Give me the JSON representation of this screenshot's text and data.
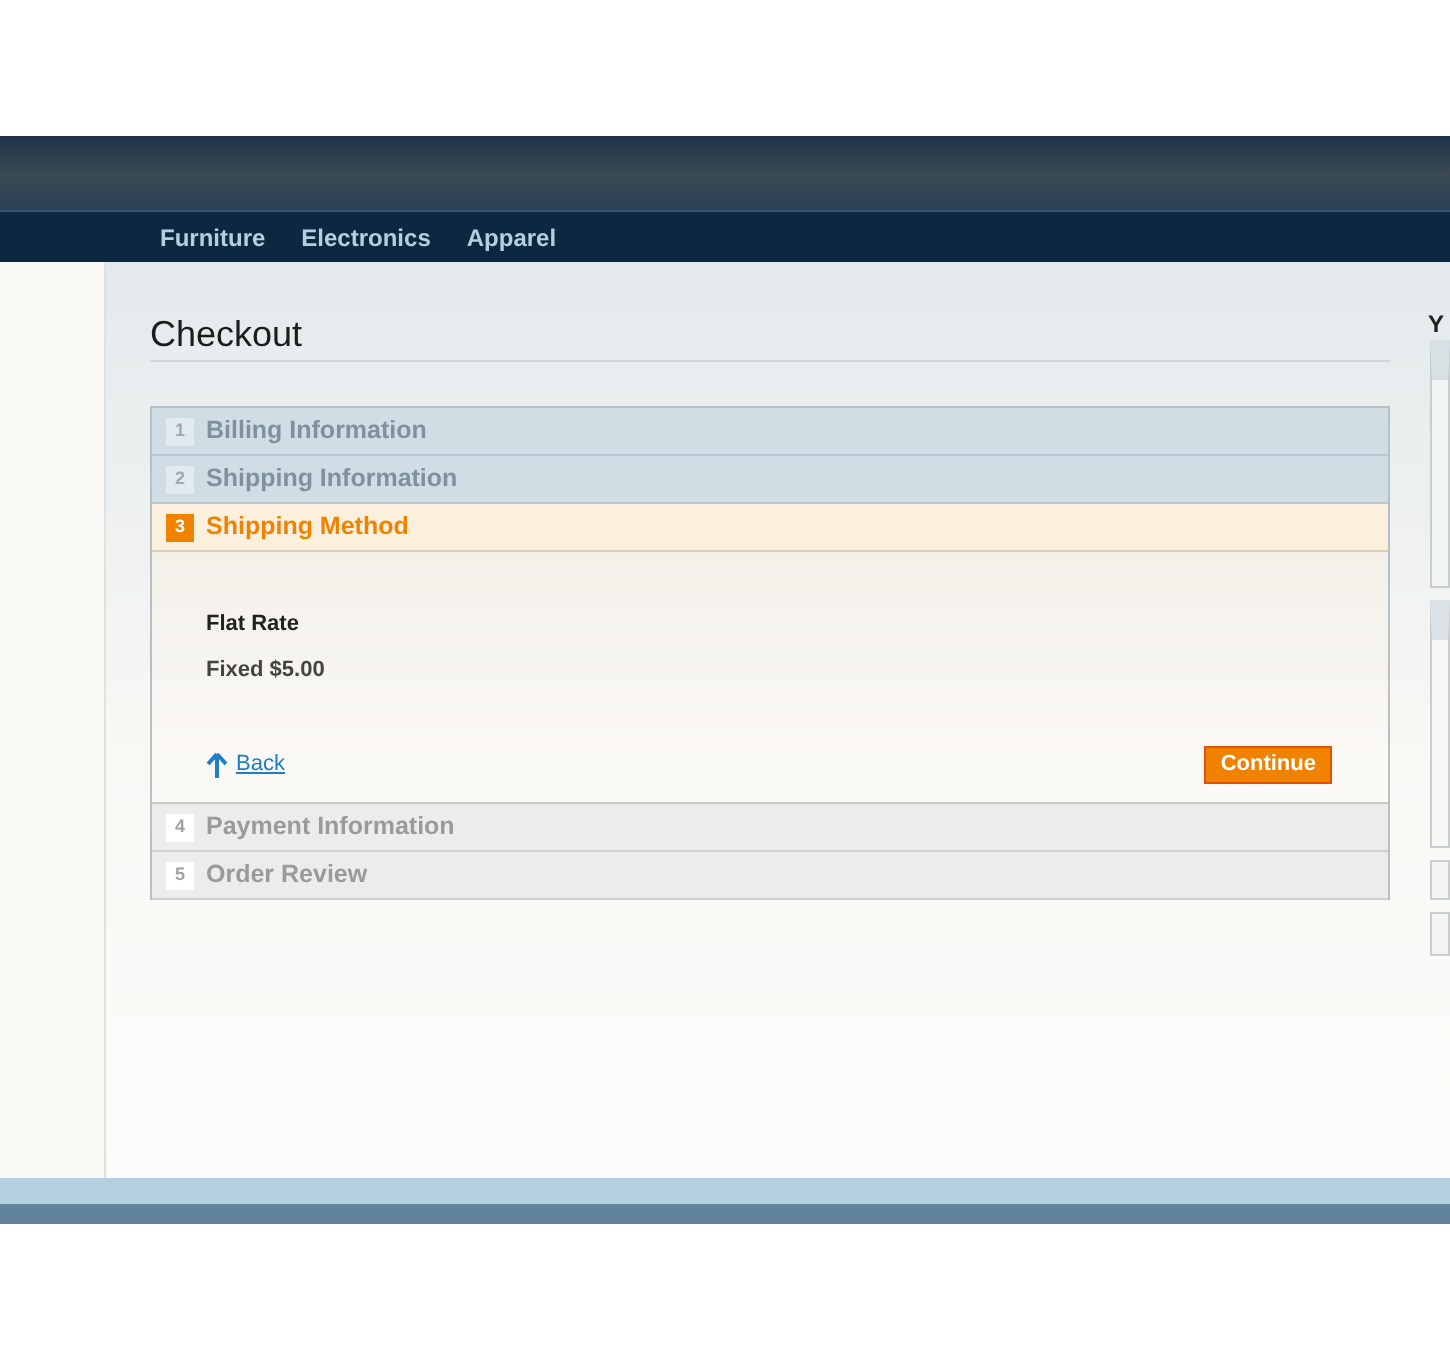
{
  "nav": {
    "items": [
      "Furniture",
      "Electronics",
      "Apparel"
    ]
  },
  "page_title": "Checkout",
  "steps": [
    {
      "number": "1",
      "label": "Billing Information",
      "kind": "complete"
    },
    {
      "number": "2",
      "label": "Shipping Information",
      "kind": "complete"
    },
    {
      "number": "3",
      "label": "Shipping Method",
      "kind": "active",
      "method_title": "Flat Rate",
      "method_price": "Fixed $5.00",
      "back_link": "Back",
      "continue_button": "Continue"
    },
    {
      "number": "4",
      "label": "Payment Information",
      "kind": "pending"
    },
    {
      "number": "5",
      "label": "Order Review",
      "kind": "pending"
    }
  ],
  "side_column": {
    "heading": "Y"
  }
}
